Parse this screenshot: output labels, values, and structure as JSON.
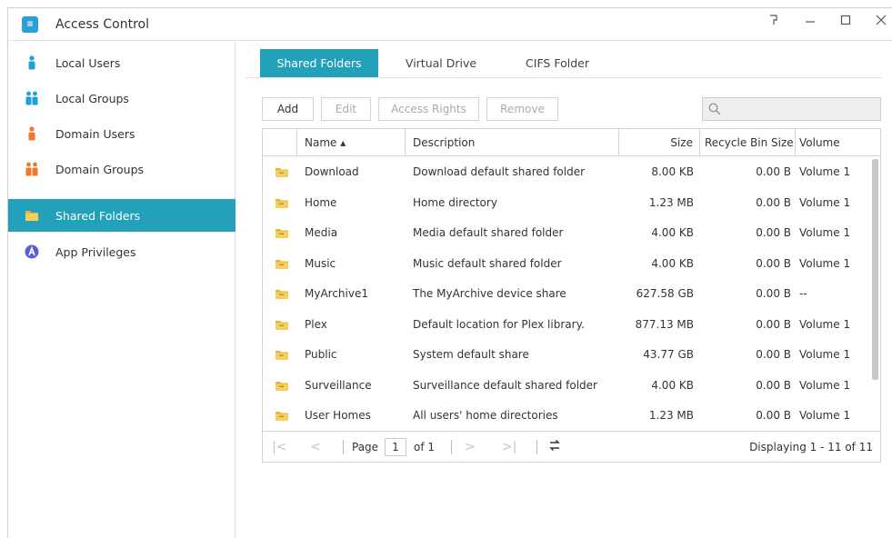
{
  "window": {
    "title": "Access Control",
    "app_icon_text": "≡",
    "controls": [
      "help",
      "minimize",
      "maximize",
      "close"
    ]
  },
  "sidebar": {
    "items": [
      {
        "label": "Local Users",
        "icon": "user-icon",
        "color": "#1ea0d8"
      },
      {
        "label": "Local Groups",
        "icon": "group-icon",
        "color": "#1ea0d8"
      },
      {
        "label": "Domain Users",
        "icon": "user-icon",
        "color": "#f07a2a"
      },
      {
        "label": "Domain Groups",
        "icon": "group-icon",
        "color": "#f07a2a"
      },
      {
        "label": "Shared Folders",
        "icon": "folder-icon",
        "color": "#e8b43a",
        "active": true
      },
      {
        "label": "App Privileges",
        "icon": "app-privileges-icon",
        "color": "#5a5fd6"
      }
    ]
  },
  "tabs": [
    {
      "label": "Shared Folders",
      "active": true
    },
    {
      "label": "Virtual Drive"
    },
    {
      "label": "CIFS Folder"
    }
  ],
  "toolbar": {
    "add": "Add",
    "edit": "Edit",
    "access_rights": "Access Rights",
    "remove": "Remove",
    "search_placeholder": ""
  },
  "table": {
    "columns": [
      "Name ▴",
      "Description",
      "Size",
      "Recycle Bin Size",
      "Volume"
    ],
    "rows": [
      {
        "name": "Download",
        "description": "Download default shared folder",
        "size": "8.00 KB",
        "recycle": "0.00 B",
        "volume": "Volume 1"
      },
      {
        "name": "Home",
        "description": "Home directory",
        "size": "1.23 MB",
        "recycle": "0.00 B",
        "volume": "Volume 1"
      },
      {
        "name": "Media",
        "description": "Media default shared folder",
        "size": "4.00 KB",
        "recycle": "0.00 B",
        "volume": "Volume 1"
      },
      {
        "name": "Music",
        "description": "Music default shared folder",
        "size": "4.00 KB",
        "recycle": "0.00 B",
        "volume": "Volume 1"
      },
      {
        "name": "MyArchive1",
        "description": "The MyArchive device share",
        "size": "627.58 GB",
        "recycle": "0.00 B",
        "volume": "--"
      },
      {
        "name": "Plex",
        "description": "Default location for Plex library.",
        "size": "877.13 MB",
        "recycle": "0.00 B",
        "volume": "Volume 1"
      },
      {
        "name": "Public",
        "description": "System default share",
        "size": "43.77 GB",
        "recycle": "0.00 B",
        "volume": "Volume 1"
      },
      {
        "name": "Surveillance",
        "description": "Surveillance default shared folder",
        "size": "4.00 KB",
        "recycle": "0.00 B",
        "volume": "Volume 1"
      },
      {
        "name": "User Homes",
        "description": "All users' home directories",
        "size": "1.23 MB",
        "recycle": "0.00 B",
        "volume": "Volume 1"
      }
    ]
  },
  "pager": {
    "first": "|<",
    "prev": "<",
    "page_label": "Page",
    "page_value": "1",
    "of_label": "of 1",
    "next": ">",
    "last": ">|",
    "refresh": "⇆",
    "displaying": "Displaying 1 - 11 of 11"
  },
  "colors": {
    "accent": "#23a0ba",
    "folder": "#e8b43a"
  }
}
